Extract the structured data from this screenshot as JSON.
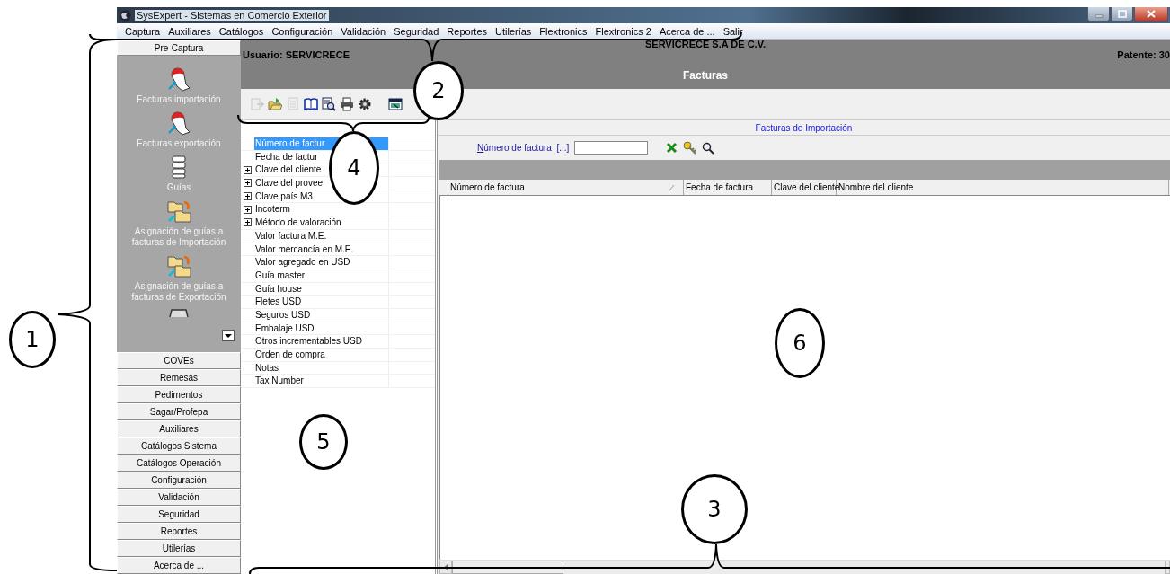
{
  "window": {
    "title": "SysExpert - Sistemas en Comercio Exterior"
  },
  "menu": [
    "Captura",
    "Auxiliares",
    "Catálogos",
    "Configuración",
    "Validación",
    "Seguridad",
    "Reportes",
    "Utilerías",
    "Flextronics",
    "Flextronics 2",
    "Acerca de ...",
    "Salir"
  ],
  "sidebar": {
    "header": "Pre-Captura",
    "items": [
      {
        "kind": "hand",
        "label": "Facturas importación"
      },
      {
        "kind": "hand",
        "label": "Facturas exportación"
      },
      {
        "kind": "stack",
        "label": "Guías"
      },
      {
        "kind": "folders",
        "label": "Asignación de guías a facturas de Importación"
      },
      {
        "kind": "folders",
        "label": "Asignación de guías a facturas de Exportación"
      },
      {
        "kind": "tray"
      }
    ],
    "sections": [
      "COVEs",
      "Remesas",
      "Pedimentos",
      "Sagar/Profepa",
      "Auxiliares",
      "Catálogos Sistema",
      "Catálogos Operación",
      "Configuración",
      "Validación",
      "Seguridad",
      "Reportes",
      "Utilerías",
      "Acerca de ..."
    ]
  },
  "header": {
    "company": "SERVICRECE S.A DE C.V.",
    "user": "Usuario: SERVICRECE",
    "patent": "Patente: 30",
    "title": "Facturas"
  },
  "toolbar": [
    {
      "kind": "arrow-doc",
      "disabled": true
    },
    {
      "kind": "open-folder",
      "disabled": false
    },
    {
      "kind": "doc",
      "disabled": true
    },
    {
      "kind": "book",
      "disabled": false
    },
    {
      "kind": "doc-search",
      "disabled": false
    },
    {
      "kind": "printer",
      "disabled": false
    },
    {
      "kind": "gear",
      "disabled": false
    },
    {
      "kind": "window",
      "disabled": false
    }
  ],
  "fields": [
    {
      "label": "Número de factur",
      "selected": true,
      "expandable": false
    },
    {
      "label": "Fecha de factur",
      "selected": false,
      "expandable": false
    },
    {
      "label": "Clave del cliente",
      "selected": false,
      "expandable": true
    },
    {
      "label": "Clave del provee",
      "selected": false,
      "expandable": true
    },
    {
      "label": "Clave país M3",
      "selected": false,
      "expandable": true
    },
    {
      "label": "Incoterm",
      "selected": false,
      "expandable": true
    },
    {
      "label": "Método de valoración",
      "selected": false,
      "expandable": true
    },
    {
      "label": "Valor factura M.E.",
      "selected": false,
      "expandable": false
    },
    {
      "label": "Valor mercancía en M.E.",
      "selected": false,
      "expandable": false
    },
    {
      "label": "Valor agregado en USD",
      "selected": false,
      "expandable": false
    },
    {
      "label": "Guía master",
      "selected": false,
      "expandable": false
    },
    {
      "label": "Guía house",
      "selected": false,
      "expandable": false
    },
    {
      "label": "Fletes USD",
      "selected": false,
      "expandable": false
    },
    {
      "label": "Seguros USD",
      "selected": false,
      "expandable": false
    },
    {
      "label": "Embalaje USD",
      "selected": false,
      "expandable": false
    },
    {
      "label": "Otros incrementables USD",
      "selected": false,
      "expandable": false
    },
    {
      "label": "Orden de compra",
      "selected": false,
      "expandable": false
    },
    {
      "label": "Notas",
      "selected": false,
      "expandable": false
    },
    {
      "label": "Tax Number",
      "selected": false,
      "expandable": false
    }
  ],
  "panel": {
    "title": "Facturas de Importación",
    "search": {
      "label": "Número de factura",
      "browse": "[...]"
    },
    "columns": [
      "Número de factura",
      "Fecha de factura",
      "Clave del cliente",
      "Nombre del cliente"
    ]
  },
  "annotations": [
    {
      "label": "1"
    },
    {
      "label": "2"
    },
    {
      "label": "3"
    },
    {
      "label": "4"
    },
    {
      "label": "5"
    },
    {
      "label": "6"
    }
  ]
}
